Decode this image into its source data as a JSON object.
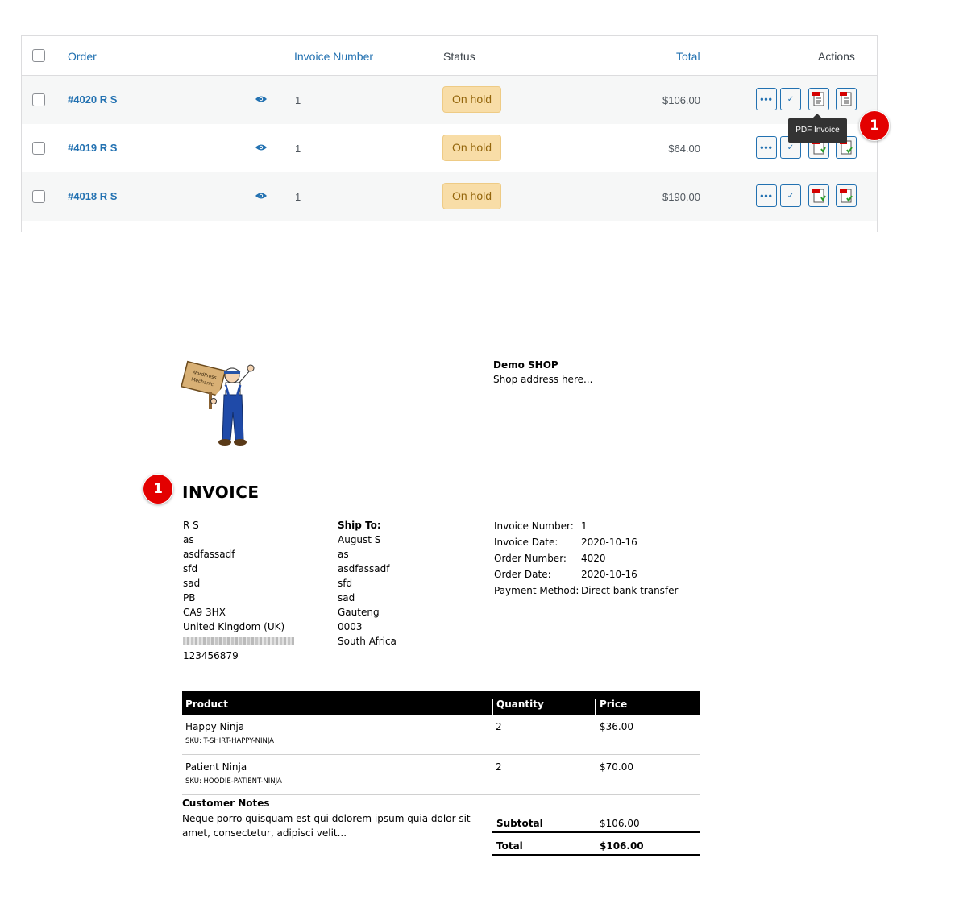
{
  "orders_table": {
    "headers": {
      "order": "Order",
      "invoice_number": "Invoice Number",
      "status": "Status",
      "total": "Total",
      "actions": "Actions"
    },
    "rows": [
      {
        "order": "#4020 R S",
        "invoice_number": "1",
        "status": "On hold",
        "total": "$106.00"
      },
      {
        "order": "#4019 R S",
        "invoice_number": "1",
        "status": "On hold",
        "total": "$64.00"
      },
      {
        "order": "#4018 R S",
        "invoice_number": "1",
        "status": "On hold",
        "total": "$190.00"
      }
    ],
    "action_more_label": "•••",
    "action_complete_label": "✓",
    "tooltip": "PDF Invoice",
    "status_color": "#f8dda7",
    "link_color": "#2271b1"
  },
  "markers": {
    "top": "1",
    "invoice": "1",
    "color": "#e30000"
  },
  "invoice": {
    "logo_text": "WordPress Mechanic",
    "shop_name": "Demo SHOP",
    "shop_address": "Shop address here...",
    "title": "INVOICE",
    "billing": {
      "lines": [
        "R S",
        "as",
        "asdfassadf",
        "sfd",
        "sad",
        "PB",
        "CA9 3HX",
        "United Kingdom (UK)"
      ],
      "phone": "123456879"
    },
    "shipping": {
      "heading": "Ship To:",
      "lines": [
        "August S",
        "as",
        "asdfassadf",
        "sfd",
        "sad",
        "Gauteng",
        "0003",
        "South Africa"
      ]
    },
    "meta": [
      {
        "label": "Invoice Number:",
        "value": "1"
      },
      {
        "label": "Invoice Date:",
        "value": "2020-10-16"
      },
      {
        "label": "Order Number:",
        "value": "4020"
      },
      {
        "label": "Order Date:",
        "value": "2020-10-16"
      },
      {
        "label": "Payment Method:",
        "value": "Direct bank transfer"
      }
    ],
    "products_header": {
      "product": "Product",
      "quantity": "Quantity",
      "price": "Price"
    },
    "products": [
      {
        "name": "Happy Ninja",
        "sku": "SKU:  T-SHIRT-HAPPY-NINJA",
        "qty": "2",
        "price": "$36.00"
      },
      {
        "name": "Patient Ninja",
        "sku": "SKU:  HOODIE-PATIENT-NINJA",
        "qty": "2",
        "price": "$70.00"
      }
    ],
    "notes_title": "Customer Notes",
    "notes_text": "Neque porro quisquam est qui dolorem ipsum quia dolor sit amet, consectetur, adipisci velit...",
    "subtotal_label": "Subtotal",
    "subtotal_value": "$106.00",
    "total_label": "Total",
    "total_value": "$106.00"
  }
}
